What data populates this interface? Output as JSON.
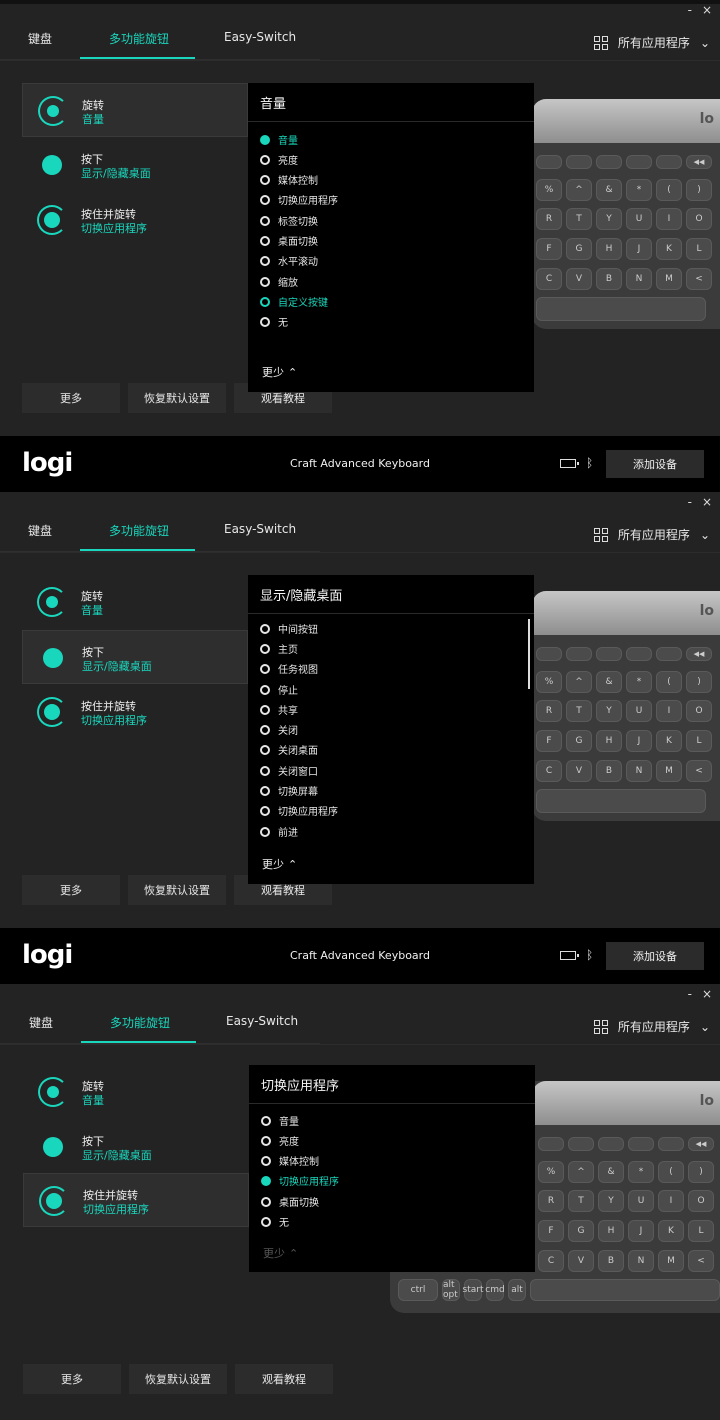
{
  "window": {
    "minimize": "-",
    "close": "×"
  },
  "tabs": [
    "键盘",
    "多功能旋钮",
    "Easy-Switch"
  ],
  "apps_label": "所有应用程序",
  "functions": [
    {
      "title": "旋转",
      "sub": "音量"
    },
    {
      "title": "按下",
      "sub": "显示/隐藏桌面"
    },
    {
      "title": "按住并旋转",
      "sub": "切换应用程序"
    }
  ],
  "buttons": {
    "more": "更多",
    "reset": "恢复默认设置",
    "tutorial": "观看教程"
  },
  "keyboard": {
    "logo": "lo",
    "fn_row": [
      "",
      "",
      "",
      "",
      "",
      "",
      "◀◀",
      "▶II"
    ],
    "row1": [
      "%",
      "^",
      "&",
      "*",
      "(",
      ")"
    ],
    "row1_sub": [
      "5",
      "6",
      "7",
      "8",
      "9",
      "0"
    ],
    "row2": [
      "R",
      "T",
      "Y",
      "U",
      "I",
      "O"
    ],
    "row3": [
      "F",
      "G",
      "H",
      "J",
      "K",
      "L"
    ],
    "row4": [
      "C",
      "V",
      "B",
      "N",
      "M",
      "<"
    ],
    "mod_row": [
      "ctrl",
      "alt opt",
      "start",
      "cmd",
      "alt"
    ]
  },
  "panel1": {
    "dropdown_title": "音量",
    "options": [
      "音量",
      "亮度",
      "媒体控制",
      "切换应用程序",
      "标签切换",
      "桌面切换",
      "水平滚动",
      "缩放",
      "自定义按键",
      "无"
    ],
    "less": "更少"
  },
  "panel2": {
    "dropdown_title": "显示/隐藏桌面",
    "options": [
      "中间按钮",
      "主页",
      "任务视图",
      "停止",
      "共享",
      "关闭",
      "关闭桌面",
      "关闭窗口",
      "切换屏幕",
      "切换应用程序",
      "前进"
    ],
    "less": "更少"
  },
  "panel3": {
    "dropdown_title": "切换应用程序",
    "options": [
      "音量",
      "亮度",
      "媒体控制",
      "切换应用程序",
      "桌面切换",
      "无"
    ],
    "less": "更少"
  },
  "devicebar": {
    "logo": "logi",
    "device": "Craft Advanced Keyboard",
    "add_device": "添加设备"
  },
  "colors": {
    "accent": "#19d7bd",
    "panel": "#232323",
    "dropdown": "#000000"
  }
}
